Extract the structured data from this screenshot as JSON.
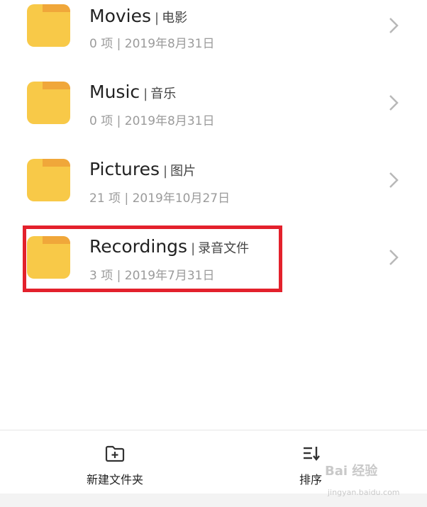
{
  "folders": [
    {
      "name": "Movies",
      "name_cn": "电影",
      "meta": "0 项 | 2019年8月31日"
    },
    {
      "name": "Music",
      "name_cn": "音乐",
      "meta": "0 项 | 2019年8月31日"
    },
    {
      "name": "Pictures",
      "name_cn": "图片",
      "meta": "21 项 | 2019年10月27日"
    },
    {
      "name": "Recordings",
      "name_cn": "录音文件",
      "meta": "3 项 | 2019年7月31日"
    }
  ],
  "bottom_bar": {
    "new_folder_label": "新建文件夹",
    "sort_label": "排序"
  },
  "watermark": {
    "text": "Bai 经验",
    "url": "jingyan.baidu.com"
  },
  "colors": {
    "folder": "#f8c948",
    "folder_tab": "#f0a73a",
    "highlight": "#e3212c"
  }
}
